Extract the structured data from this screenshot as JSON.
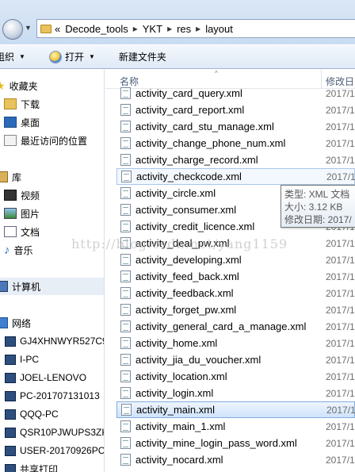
{
  "address": {
    "overflow": "«",
    "crumbs": [
      "Decode_tools",
      "YKT",
      "res",
      "layout"
    ],
    "separator": "▸"
  },
  "toolbar": {
    "organize": "组织",
    "open": "打开",
    "new_folder": "新建文件夹"
  },
  "nav": {
    "favorites": "收藏夹",
    "downloads": "下载",
    "desktop": "桌面",
    "recent": "最近访问的位置",
    "libraries": "库",
    "videos": "视频",
    "pictures": "图片",
    "documents": "文档",
    "music": "音乐",
    "computer": "计算机",
    "network": "网络",
    "network_items": [
      "GJ4XHNWYR527C9",
      "I-PC",
      "JOEL-LENOVO",
      "PC-201707131013",
      "QQQ-PC",
      "QSR10PJWUPS3ZK",
      "USER-20170926PC",
      "共享打印"
    ]
  },
  "columns": {
    "name": "名称",
    "date": "修改日"
  },
  "files": [
    {
      "name": "activity_card_query.xml",
      "date": "2017/1"
    },
    {
      "name": "activity_card_report.xml",
      "date": "2017/1"
    },
    {
      "name": "activity_card_stu_manage.xml",
      "date": "2017/1"
    },
    {
      "name": "activity_change_phone_num.xml",
      "date": "2017/1"
    },
    {
      "name": "activity_charge_record.xml",
      "date": "2017/1"
    },
    {
      "name": "activity_checkcode.xml",
      "date": "2017/1"
    },
    {
      "name": "activity_circle.xml",
      "date": "2017/1"
    },
    {
      "name": "activity_consumer.xml",
      "date": "2017/1"
    },
    {
      "name": "activity_credit_licence.xml",
      "date": "2017/1"
    },
    {
      "name": "activity_deal_pw.xml",
      "date": "2017/1"
    },
    {
      "name": "activity_developing.xml",
      "date": "2017/1"
    },
    {
      "name": "activity_feed_back.xml",
      "date": "2017/1"
    },
    {
      "name": "activity_feedback.xml",
      "date": "2017/1"
    },
    {
      "name": "activity_forget_pw.xml",
      "date": "2017/1"
    },
    {
      "name": "activity_general_card_a_manage.xml",
      "date": "2017/1"
    },
    {
      "name": "activity_home.xml",
      "date": "2017/1"
    },
    {
      "name": "activity_jia_du_voucher.xml",
      "date": "2017/1"
    },
    {
      "name": "activity_location.xml",
      "date": "2017/1"
    },
    {
      "name": "activity_login.xml",
      "date": "2017/1"
    },
    {
      "name": "activity_main.xml",
      "date": "2017/1"
    },
    {
      "name": "activity_main_1.xml",
      "date": "2017/1"
    },
    {
      "name": "activity_mine_login_pass_word.xml",
      "date": "2017/1"
    },
    {
      "name": "activity_nocard.xml",
      "date": "2017/1"
    }
  ],
  "tooltip": {
    "type": "类型: XML 文档",
    "size": "大小: 3.12 KB",
    "modified": "修改日期: 2017/"
  },
  "watermark": "http://blog.csdn.net/yang1159"
}
